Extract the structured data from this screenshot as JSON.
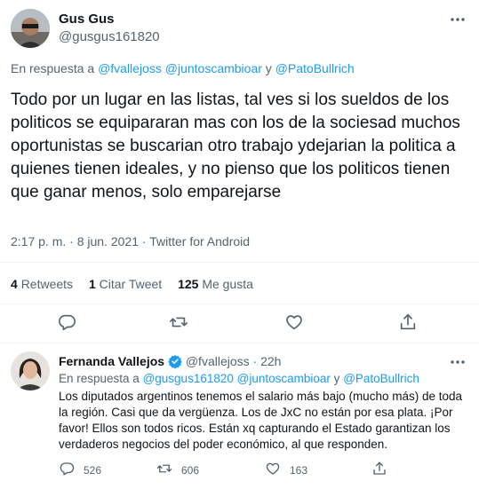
{
  "main_tweet": {
    "author_name": "Gus Gus",
    "author_handle": "@gusgus161820",
    "reply_prefix": "En respuesta a",
    "reply_to": [
      "@fvallejoss",
      "@juntoscambioar"
    ],
    "reply_and": "y",
    "reply_last": "@PatoBullrich",
    "text": "Todo por un lugar en las listas, tal ves si los sueldos de los politicos se equipararan mas con los de la sociesad muchos oportunistas se buscarian otro trabajo ydejarian la politica a quienes tienen ideales, y no pienso que los politicos tienen que ganar menos, solo emparejarse",
    "time": "2:17 p. m.",
    "sep": "·",
    "date": "8 jun. 2021",
    "source": "Twitter for Android",
    "stats": {
      "retweets_count": "4",
      "retweets_label": "Retweets",
      "quotes_count": "1",
      "quotes_label": "Citar Tweet",
      "likes_count": "125",
      "likes_label": "Me gusta"
    }
  },
  "reply_tweet": {
    "author_name": "Fernanda Vallejos",
    "author_handle": "@fvallejoss",
    "sep": "·",
    "time": "22h",
    "reply_prefix": "En respuesta a",
    "reply_to": [
      "@gusgus161820",
      "@juntoscambioar"
    ],
    "reply_and": "y",
    "reply_last": "@PatoBullrich",
    "text": "Los diputados argentinos tenemos el salario más bajo (mucho más) de toda la región. Casi que da vergüenza. Los de JxC no están por esa plata. ¡Por favor! Ellos son todos ricos. Están xq capturando el Estado garantizan los verdaderos negocios del poder económico, al que responden.",
    "replies": "526",
    "retweets": "606",
    "likes": "163"
  },
  "colors": {
    "accent": "#1d9bf0",
    "muted": "#536471",
    "text": "#0f1419",
    "divider": "#eff3f4"
  },
  "icons": [
    "more-icon",
    "reply-icon",
    "retweet-icon",
    "like-icon",
    "share-icon",
    "verified-icon"
  ]
}
